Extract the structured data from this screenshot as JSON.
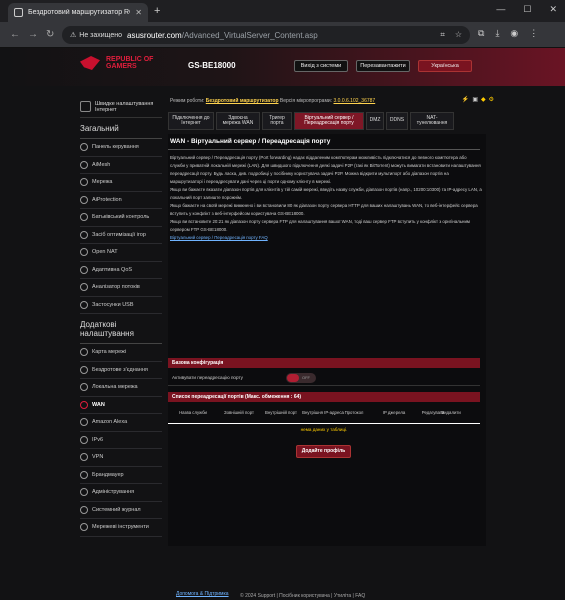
{
  "browser": {
    "tab_title": "Бездротовий маршрутизатор ROG",
    "warn_text": "Не захищено",
    "url_host": "asusrouter.com",
    "url_path": "/Advanced_VirtualServer_Content.asp"
  },
  "header": {
    "logo_text": "REPUBLIC OF GAMERS",
    "model": "GS-BE18000",
    "logout_label": "Вихід з системи",
    "reboot_label": "Перезавантажити",
    "language_label": "Українська"
  },
  "sidebar": {
    "quick_label": "Швидке налаштування Інтернет",
    "general_title": "Загальний",
    "general_items": [
      {
        "label": "Панель керування",
        "icon": "dashboard-icon"
      },
      {
        "label": "AiMesh",
        "icon": "aimesh-icon"
      },
      {
        "label": "Мережа",
        "icon": "network-map-icon"
      },
      {
        "label": "AiProtection",
        "icon": "shield-icon"
      },
      {
        "label": "Батьківський контроль",
        "icon": "parental-icon"
      },
      {
        "label": "Засіб оптимізації ігор",
        "icon": "game-boost-icon"
      },
      {
        "label": "Open NAT",
        "icon": "open-nat-icon"
      },
      {
        "label": "Адаптивна QoS",
        "icon": "qos-icon"
      },
      {
        "label": "Аналізатор потоків",
        "icon": "traffic-analyzer-icon"
      },
      {
        "label": "Застосунки USB",
        "icon": "usb-icon"
      }
    ],
    "advanced_title": "Додаткові налаштування",
    "advanced_items": [
      {
        "label": "Карта мережі",
        "icon": "map-icon",
        "active": false
      },
      {
        "label": "Бездротове з'єднання",
        "icon": "wireless-icon",
        "active": false
      },
      {
        "label": "Локальна мережа",
        "icon": "lan-icon",
        "active": false
      },
      {
        "label": "WAN",
        "icon": "wan-icon",
        "active": true
      },
      {
        "label": "Amazon Alexa",
        "icon": "alexa-icon",
        "active": false
      },
      {
        "label": "IPv6",
        "icon": "ipv6-icon",
        "active": false
      },
      {
        "label": "VPN",
        "icon": "vpn-icon",
        "active": false
      },
      {
        "label": "Брандмауер",
        "icon": "firewall-icon",
        "active": false
      },
      {
        "label": "Адміністрування",
        "icon": "admin-icon",
        "active": false
      },
      {
        "label": "Системний журнал",
        "icon": "log-icon",
        "active": false
      },
      {
        "label": "Мережеві інструменти",
        "icon": "tools-icon",
        "active": false
      }
    ]
  },
  "status": {
    "mode_label": "Режим роботи:",
    "mode_value": "Бездротовий маршрутизатор",
    "fw_label": "Версія мікропрограми:",
    "fw_value": "3.0.0.6.102_36787"
  },
  "tabs": [
    {
      "label": "Підключення до Інтернет",
      "active": false
    },
    {
      "label": "Здвоєна мережа WAN",
      "active": false
    },
    {
      "label": "Тригер порта",
      "active": false
    },
    {
      "label": "Віртуальний сервер / Переадресація порту",
      "active": true
    },
    {
      "label": "DMZ",
      "active": false
    },
    {
      "label": "DDNS",
      "active": false
    },
    {
      "label": "NAT-тунелювання",
      "active": false
    }
  ],
  "content": {
    "title": "WAN - Віртуальний сервер / Переадресація порту",
    "desc_p1": "Віртуальний сервер / Переадресація порту (Port forwarding) надає віддаленим комп'ютерам можливість підключатися до певного комп'ютера або служби у приватній локальній мережі (LAN). Для швидшого підключення деякі задачі P2P (такі як BitTorrent) можуть вимагати встановити налаштування переадресації порту. Будь ласка, див. подробиці у посібнику користувача задачі P2P. Можна відкрити мультипорт або діапазон портів на маршрутизаторі і переадресувати дані через ці порти одному клієнту в мережі.",
    "desc_p2": "Якщо ви бажаєте вказати діапазон портів для клієнтів у тій самій мережі, введіть назву служби, діапазон портів (напр., 10200:10300) та IP-адресу LAN, а локальний порт залиште порожнім.",
    "desc_p3": "Якщо бажаєте на своїй мережі вимкнено і ви встановили 80 як діапазон порту сервера HTTP для ваших налаштувань WAN, то веб-інтерфейс сервера вступить у конфлікт з веб-інтерфейсом користувача GS-BE18000.",
    "desc_p4": "Якщо ви встановите 20:21 як діапазон порту сервера FTP для налаштування вашої WAN, тоді ваш сервер FTP вступить у конфлікт з оригінальним сервером FTP GS-BE18000.",
    "faq_link": "Віртуальний сервер / Переадресація порту FAQ",
    "basic_config_head": "Базова конфігурація",
    "enable_label": "Активувати переадресацію порту",
    "toggle_text": "OFF",
    "list_head": "Список переадресації портів (Макс. обмеження : 64)",
    "columns": [
      "Назва служби",
      "Зовнішній порт",
      "Внутрішній порт",
      "Внутрішня IP-адреса",
      "Протокол",
      "IP джерела",
      "Редагувати",
      "Видалити"
    ],
    "no_data": "нема даних у таблиці.",
    "add_button": "Додайте профіль"
  },
  "footer": {
    "help_link": "Допомога & Підтримка",
    "copyright": "© 2024 Support | Посібник користувача | Утиліта | FAQ"
  }
}
